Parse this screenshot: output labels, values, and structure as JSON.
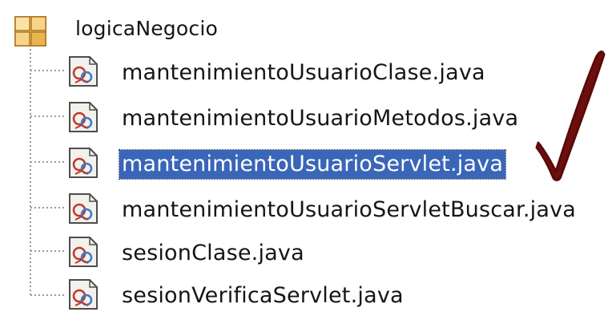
{
  "tree": {
    "root": {
      "label": "logicaNegocio",
      "icon": "package-icon"
    },
    "files": [
      {
        "label": "mantenimientoUsuarioClase.java",
        "icon": "java-file-icon",
        "selected": false
      },
      {
        "label": "mantenimientoUsuarioMetodos.java",
        "icon": "java-file-icon",
        "selected": false
      },
      {
        "label": "mantenimientoUsuarioServlet.java",
        "icon": "java-file-icon",
        "selected": true
      },
      {
        "label": "mantenimientoUsuarioServletBuscar.java",
        "icon": "java-file-icon",
        "selected": false
      },
      {
        "label": "sesionClase.java",
        "icon": "java-file-icon",
        "selected": false
      },
      {
        "label": "sesionVerificaServlet.java",
        "icon": "java-file-icon",
        "selected": false
      }
    ]
  },
  "annotation": {
    "icon": "checkmark-icon",
    "color": "#6e0f0f"
  },
  "colors": {
    "selection": "#3a66b8",
    "selection_text": "#ffffff",
    "text": "#151515"
  }
}
